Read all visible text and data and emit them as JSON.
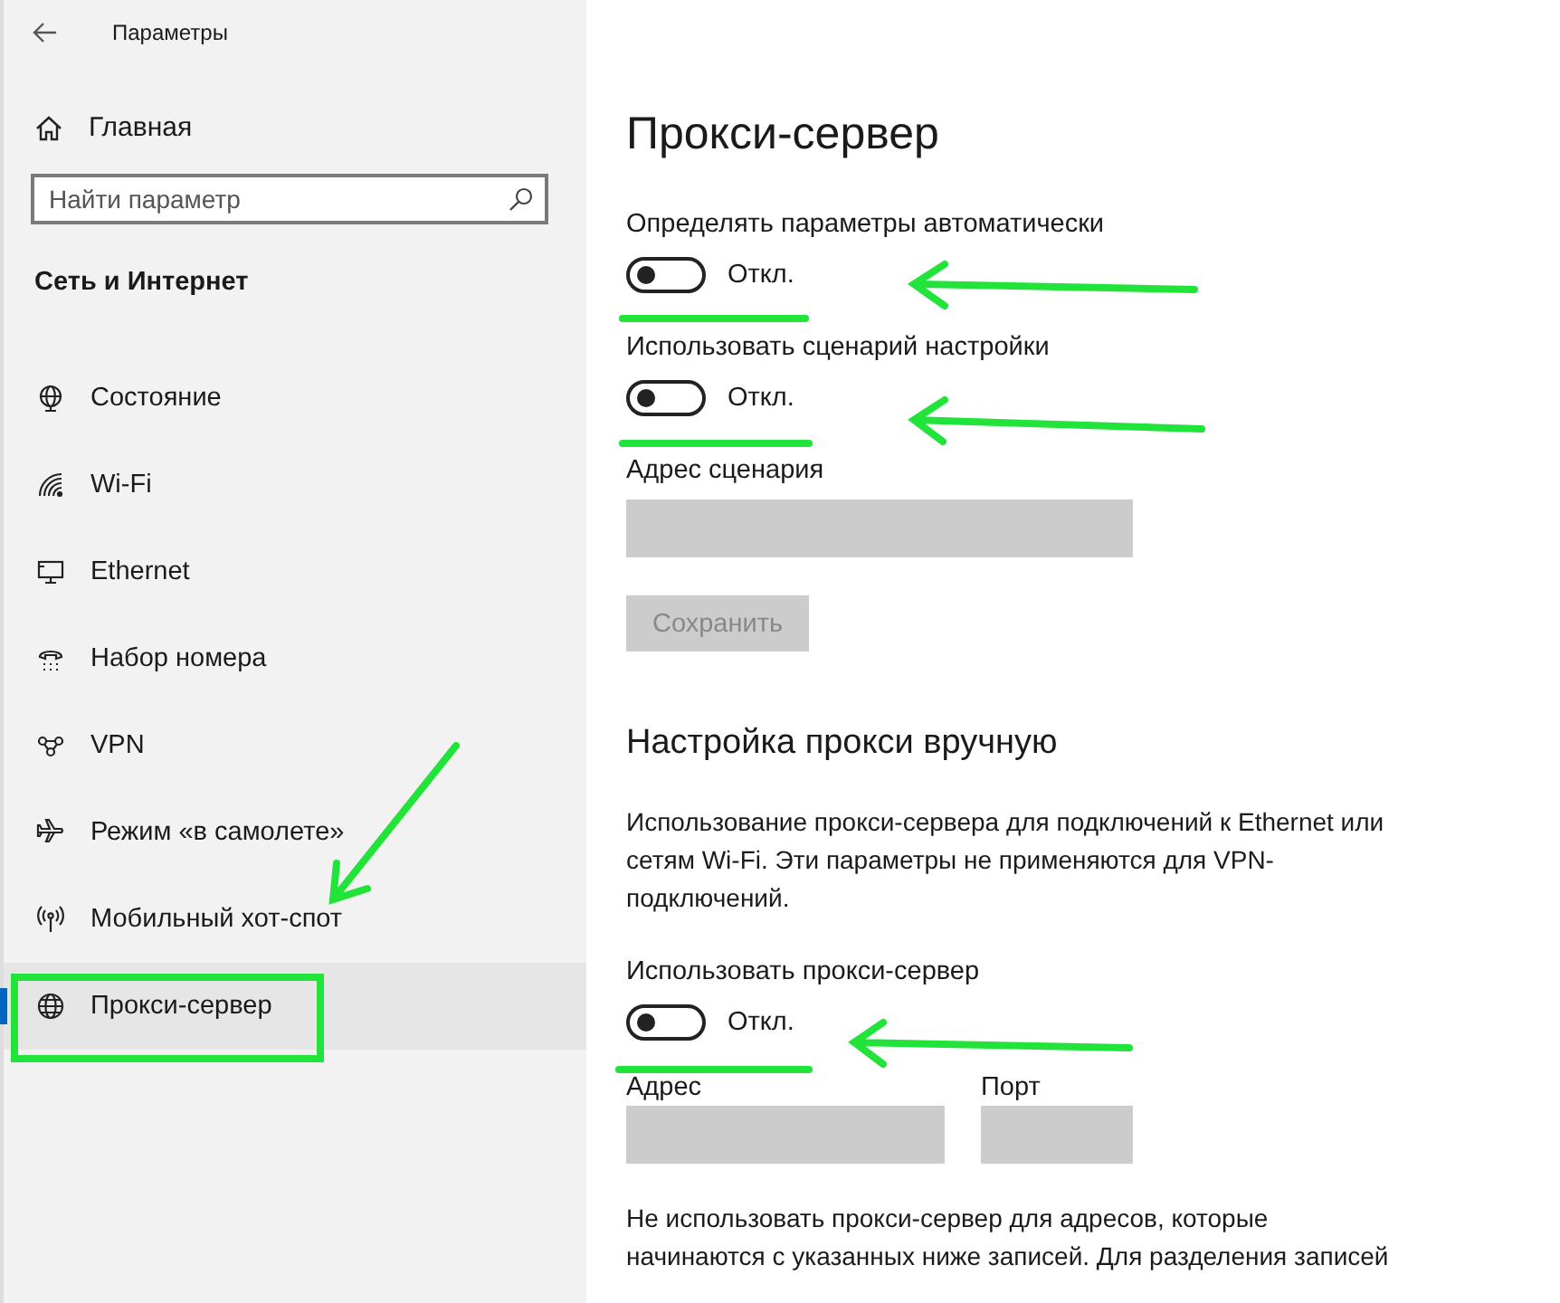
{
  "window": {
    "title": "Параметры"
  },
  "sidebar": {
    "home": "Главная",
    "search": {
      "placeholder": "Найти параметр"
    },
    "section": "Сеть и Интернет",
    "items": [
      {
        "label": "Состояние",
        "selected": false
      },
      {
        "label": "Wi-Fi",
        "selected": false
      },
      {
        "label": "Ethernet",
        "selected": false
      },
      {
        "label": "Набор номера",
        "selected": false
      },
      {
        "label": "VPN",
        "selected": false
      },
      {
        "label": "Режим «в самолете»",
        "selected": false
      },
      {
        "label": "Мобильный хот-спот",
        "selected": false
      },
      {
        "label": "Прокси-сервер",
        "selected": true
      }
    ]
  },
  "main": {
    "title": "Прокси-сервер",
    "auto": [
      {
        "kind": "toggle",
        "label": "Определять параметры автоматически",
        "on": false,
        "state": "Откл."
      },
      {
        "kind": "toggle",
        "label": "Использовать сценарий настройки",
        "on": false,
        "state": "Откл."
      },
      {
        "kind": "field",
        "label": "Адрес сценария"
      },
      {
        "kind": "button",
        "label": "Сохранить",
        "disabled": true
      }
    ],
    "manual_title": "Настройка прокси вручную",
    "manual_text": "Использование прокси-сервера для подключений к Ethernet или сетям Wi-Fi. Эти параметры не применяются для VPN-подключений.",
    "manual_toggle": {
      "label": "Использовать прокси-сервер",
      "on": false,
      "state": "Откл."
    },
    "address": {
      "label": "Адрес"
    },
    "port": {
      "label": "Порт"
    },
    "exceptions_text": "Не использовать прокси-сервер для адресов, которые начинаются с указанных ниже записей. Для разделения записей"
  }
}
